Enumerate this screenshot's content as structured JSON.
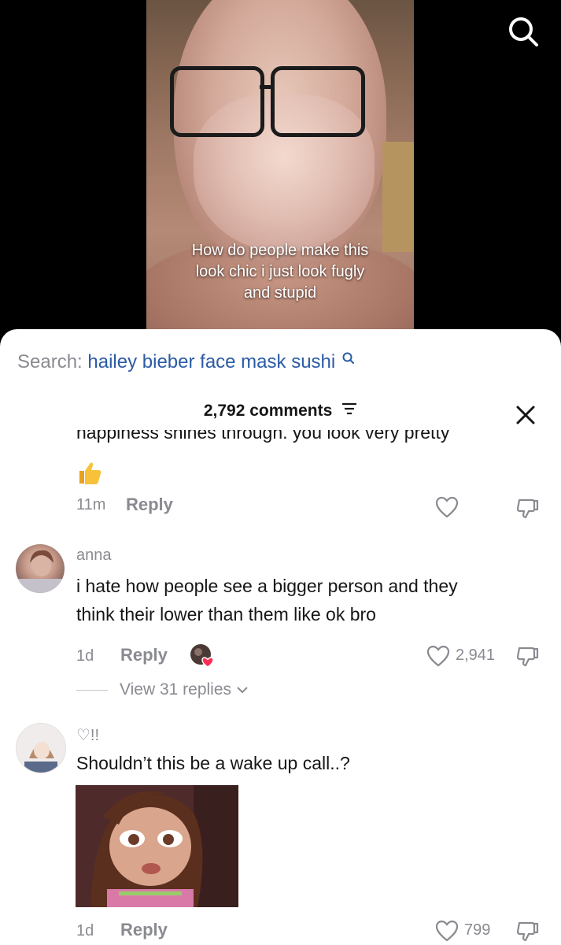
{
  "video": {
    "overlay_lines": [
      "How do people make this",
      "look chic i just look fugly",
      "and stupid"
    ]
  },
  "sheet": {
    "search_label": "Search:",
    "search_query": "hailey bieber face mask sushi",
    "comments_count": "2,792 comments"
  },
  "comments": [
    {
      "cut_text": "happiness shines through. you look very pretty",
      "time": "11m",
      "reply_label": "Reply"
    },
    {
      "username": "anna",
      "text_lines": [
        "i hate how people see a bigger person and they",
        "think their lower than them like ok bro"
      ],
      "time": "1d",
      "reply_label": "Reply",
      "likes": "2,941",
      "view_replies": "View 31 replies"
    },
    {
      "username": "♡!!",
      "text": "Shouldn’t this be a wake up call..?",
      "time": "1d",
      "reply_label": "Reply",
      "likes": "799"
    }
  ],
  "colors": {
    "accent_link": "#2b5ba5",
    "muted": "#8a8b91",
    "heart_badge": "#fe2c55"
  },
  "icons": [
    "search-icon",
    "sort-icon",
    "close-icon",
    "thumbs-up-icon",
    "heart-icon",
    "dislike-icon",
    "chevron-down-icon"
  ]
}
